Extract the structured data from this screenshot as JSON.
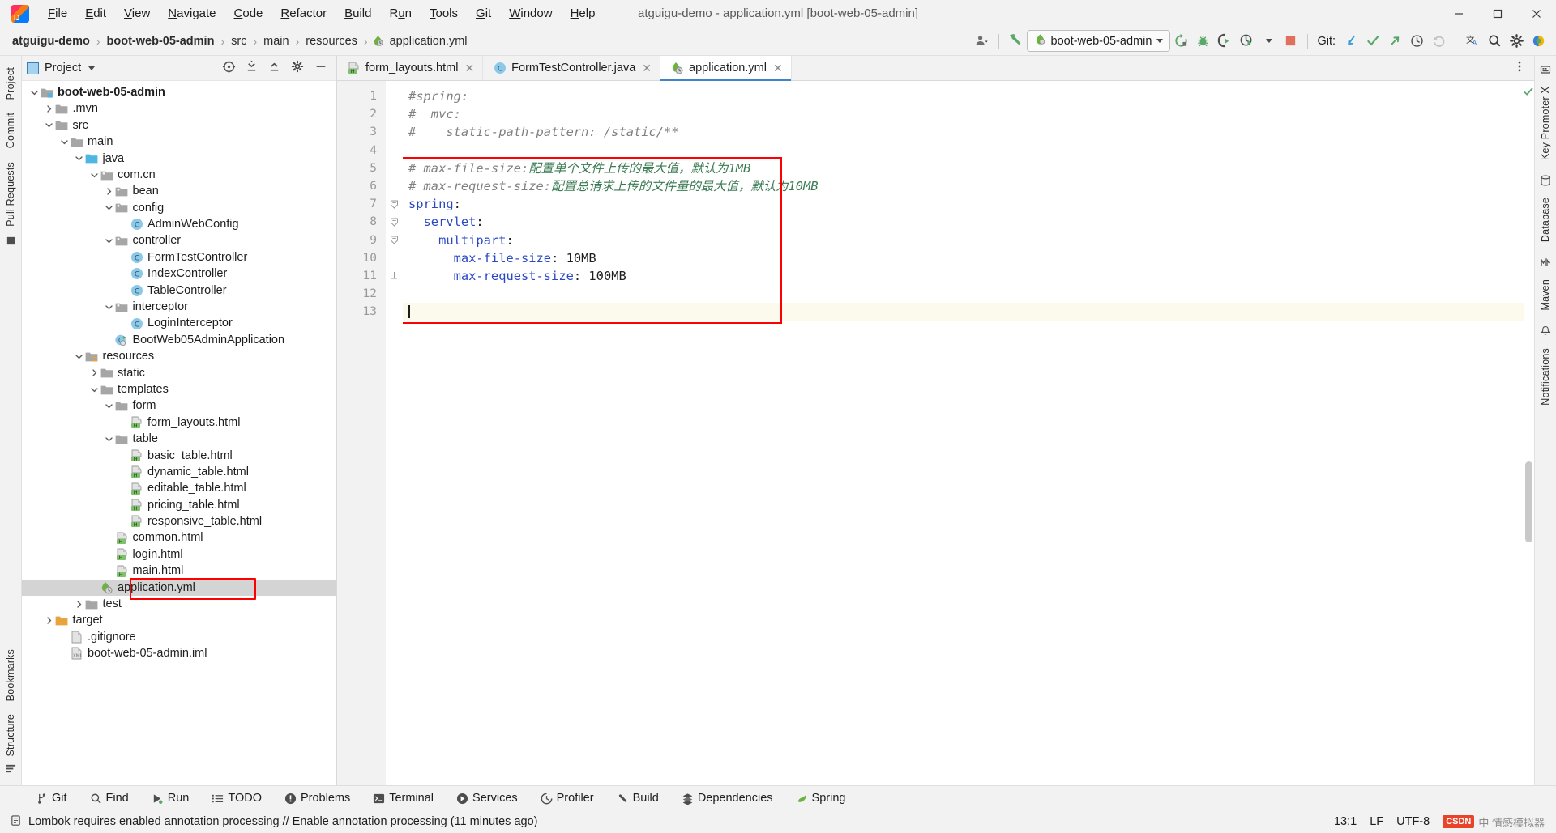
{
  "window": {
    "title": "atguigu-demo - application.yml [boot-web-05-admin]",
    "minimize": "—",
    "maximize": "❐",
    "close": "✕"
  },
  "menubar": {
    "items": [
      {
        "label": "File",
        "mnemonic": "F"
      },
      {
        "label": "Edit",
        "mnemonic": "E"
      },
      {
        "label": "View",
        "mnemonic": "V"
      },
      {
        "label": "Navigate",
        "mnemonic": "N"
      },
      {
        "label": "Code",
        "mnemonic": "C"
      },
      {
        "label": "Refactor",
        "mnemonic": "R"
      },
      {
        "label": "Build",
        "mnemonic": "B"
      },
      {
        "label": "Run",
        "mnemonic": "u"
      },
      {
        "label": "Tools",
        "mnemonic": "T"
      },
      {
        "label": "Git",
        "mnemonic": "G"
      },
      {
        "label": "Window",
        "mnemonic": "W"
      },
      {
        "label": "Help",
        "mnemonic": "H"
      }
    ]
  },
  "navbar": {
    "breadcrumbs": [
      {
        "label": "atguigu-demo",
        "bold": true
      },
      {
        "label": "boot-web-05-admin",
        "bold": true
      },
      {
        "label": "src",
        "bold": false
      },
      {
        "label": "main",
        "bold": false
      },
      {
        "label": "resources",
        "bold": false
      },
      {
        "label": "application.yml",
        "bold": false,
        "icon": "yml-file-icon"
      }
    ],
    "separator": "›",
    "run_config": "boot-web-05-admin",
    "git_label": "Git:"
  },
  "left_strip": {
    "top": [
      "Project",
      "Commit",
      "Pull Requests"
    ],
    "bottom": [
      "Bookmarks",
      "Structure"
    ]
  },
  "right_strip": {
    "items": [
      "Key Promoter X",
      "Database",
      "Maven",
      "Notifications"
    ]
  },
  "project_panel": {
    "title": "Project",
    "tree": [
      {
        "depth": 0,
        "arrow": "down",
        "icon": "module-icon",
        "label": "boot-web-05-admin",
        "bold": true
      },
      {
        "depth": 1,
        "arrow": "right",
        "icon": "folder-icon",
        "label": ".mvn"
      },
      {
        "depth": 1,
        "arrow": "down",
        "icon": "folder-icon",
        "label": "src"
      },
      {
        "depth": 2,
        "arrow": "down",
        "icon": "folder-icon",
        "label": "main"
      },
      {
        "depth": 3,
        "arrow": "down",
        "icon": "source-root-icon",
        "label": "java"
      },
      {
        "depth": 4,
        "arrow": "down",
        "icon": "package-icon",
        "label": "com.cn"
      },
      {
        "depth": 5,
        "arrow": "right",
        "icon": "package-icon",
        "label": "bean"
      },
      {
        "depth": 5,
        "arrow": "down",
        "icon": "package-icon",
        "label": "config"
      },
      {
        "depth": 6,
        "arrow": "none",
        "icon": "class-icon",
        "label": "AdminWebConfig"
      },
      {
        "depth": 5,
        "arrow": "down",
        "icon": "package-icon",
        "label": "controller"
      },
      {
        "depth": 6,
        "arrow": "none",
        "icon": "class-icon",
        "label": "FormTestController"
      },
      {
        "depth": 6,
        "arrow": "none",
        "icon": "class-icon",
        "label": "IndexController"
      },
      {
        "depth": 6,
        "arrow": "none",
        "icon": "class-icon",
        "label": "TableController"
      },
      {
        "depth": 5,
        "arrow": "down",
        "icon": "package-icon",
        "label": "interceptor"
      },
      {
        "depth": 6,
        "arrow": "none",
        "icon": "class-icon",
        "label": "LoginInterceptor"
      },
      {
        "depth": 5,
        "arrow": "none",
        "icon": "spring-class-icon",
        "label": "BootWeb05AdminApplication"
      },
      {
        "depth": 3,
        "arrow": "down",
        "icon": "resource-root-icon",
        "label": "resources"
      },
      {
        "depth": 4,
        "arrow": "right",
        "icon": "folder-icon",
        "label": "static"
      },
      {
        "depth": 4,
        "arrow": "down",
        "icon": "folder-icon",
        "label": "templates"
      },
      {
        "depth": 5,
        "arrow": "down",
        "icon": "folder-icon",
        "label": "form"
      },
      {
        "depth": 6,
        "arrow": "none",
        "icon": "html-file-icon",
        "label": "form_layouts.html"
      },
      {
        "depth": 5,
        "arrow": "down",
        "icon": "folder-icon",
        "label": "table"
      },
      {
        "depth": 6,
        "arrow": "none",
        "icon": "html-file-icon",
        "label": "basic_table.html"
      },
      {
        "depth": 6,
        "arrow": "none",
        "icon": "html-file-icon",
        "label": "dynamic_table.html"
      },
      {
        "depth": 6,
        "arrow": "none",
        "icon": "html-file-icon",
        "label": "editable_table.html"
      },
      {
        "depth": 6,
        "arrow": "none",
        "icon": "html-file-icon",
        "label": "pricing_table.html"
      },
      {
        "depth": 6,
        "arrow": "none",
        "icon": "html-file-icon",
        "label": "responsive_table.html"
      },
      {
        "depth": 5,
        "arrow": "none",
        "icon": "html-file-icon",
        "label": "common.html"
      },
      {
        "depth": 5,
        "arrow": "none",
        "icon": "html-file-icon",
        "label": "login.html"
      },
      {
        "depth": 5,
        "arrow": "none",
        "icon": "html-file-icon",
        "label": "main.html"
      },
      {
        "depth": 4,
        "arrow": "none",
        "icon": "yml-file-icon",
        "label": "application.yml",
        "selected": true,
        "highlighted": true
      },
      {
        "depth": 3,
        "arrow": "right",
        "icon": "folder-icon",
        "label": "test"
      },
      {
        "depth": 1,
        "arrow": "right",
        "icon": "target-folder-icon",
        "label": "target"
      },
      {
        "depth": 2,
        "arrow": "none",
        "icon": "file-icon",
        "label": ".gitignore"
      },
      {
        "depth": 2,
        "arrow": "none",
        "icon": "xml-file-icon",
        "label": "boot-web-05-admin.iml"
      }
    ]
  },
  "editor": {
    "tabs": [
      {
        "label": "form_layouts.html",
        "icon": "html-file-icon",
        "active": false,
        "closable": true
      },
      {
        "label": "FormTestController.java",
        "icon": "class-icon",
        "active": false,
        "closable": true
      },
      {
        "label": "application.yml",
        "icon": "yml-file-icon",
        "active": true,
        "closable": true
      }
    ],
    "lines": [
      {
        "n": 1,
        "fold": "none",
        "tokens": [
          {
            "t": "#spring:",
            "c": "cm"
          }
        ]
      },
      {
        "n": 2,
        "fold": "none",
        "tokens": [
          {
            "t": "#  mvc:",
            "c": "cm"
          }
        ]
      },
      {
        "n": 3,
        "fold": "none",
        "tokens": [
          {
            "t": "#    static-path-pattern: /static/**",
            "c": "cm"
          }
        ]
      },
      {
        "n": 4,
        "fold": "none",
        "tokens": [
          {
            "t": "",
            "c": "cm"
          }
        ]
      },
      {
        "n": 5,
        "fold": "none",
        "tokens": [
          {
            "t": "# max-file-size:",
            "c": "cm"
          },
          {
            "t": "配置单个文件上传的最大值，默认为1MB",
            "c": "cm-cn"
          }
        ]
      },
      {
        "n": 6,
        "fold": "none",
        "tokens": [
          {
            "t": "# max-request-size:",
            "c": "cm"
          },
          {
            "t": "配置总请求上传的文件量的最大值，默认为10MB",
            "c": "cm-cn"
          }
        ]
      },
      {
        "n": 7,
        "fold": "open",
        "tokens": [
          {
            "t": "spring",
            "c": "key"
          },
          {
            "t": ":",
            "c": "punc"
          }
        ]
      },
      {
        "n": 8,
        "fold": "open",
        "tokens": [
          {
            "t": "  servlet",
            "c": "key"
          },
          {
            "t": ":",
            "c": "punc"
          }
        ]
      },
      {
        "n": 9,
        "fold": "open",
        "tokens": [
          {
            "t": "    multipart",
            "c": "key"
          },
          {
            "t": ":",
            "c": "punc"
          }
        ]
      },
      {
        "n": 10,
        "fold": "none",
        "tokens": [
          {
            "t": "      max-file-size",
            "c": "key"
          },
          {
            "t": ": ",
            "c": "punc"
          },
          {
            "t": "10MB",
            "c": "val"
          }
        ]
      },
      {
        "n": 11,
        "fold": "end",
        "tokens": [
          {
            "t": "      max-request-size",
            "c": "key"
          },
          {
            "t": ": ",
            "c": "punc"
          },
          {
            "t": "100MB",
            "c": "val"
          }
        ]
      },
      {
        "n": 12,
        "fold": "none",
        "tokens": [
          {
            "t": "",
            "c": "val"
          }
        ]
      },
      {
        "n": 13,
        "fold": "none",
        "current": true,
        "caret": true,
        "tokens": [
          {
            "t": "",
            "c": "val"
          }
        ]
      }
    ]
  },
  "bottom_bar": {
    "items": [
      {
        "label": "Git",
        "icon": "git-branch-icon"
      },
      {
        "label": "Find",
        "icon": "search-icon"
      },
      {
        "label": "Run",
        "icon": "run-icon"
      },
      {
        "label": "TODO",
        "icon": "todo-icon"
      },
      {
        "label": "Problems",
        "icon": "problems-icon"
      },
      {
        "label": "Terminal",
        "icon": "terminal-icon"
      },
      {
        "label": "Services",
        "icon": "services-icon"
      },
      {
        "label": "Profiler",
        "icon": "profiler-icon"
      },
      {
        "label": "Build",
        "icon": "build-icon"
      },
      {
        "label": "Dependencies",
        "icon": "dependencies-icon"
      },
      {
        "label": "Spring",
        "icon": "spring-icon"
      }
    ]
  },
  "status_bar": {
    "message": "Lombok requires enabled annotation processing // Enable annotation processing (11 minutes ago)",
    "caret_position": "13:1",
    "line_separator": "LF",
    "encoding": "UTF-8",
    "watermark_badge": "CSDN",
    "watermark_text": "中 情感模拟器"
  },
  "colors": {
    "accent": "#4083c9",
    "highlight_box": "#ff0000",
    "comment_green": "#3a7a52",
    "key_blue": "#2a48c4",
    "selection_gray": "#d4d4d4",
    "current_line": "#fcfaed"
  }
}
